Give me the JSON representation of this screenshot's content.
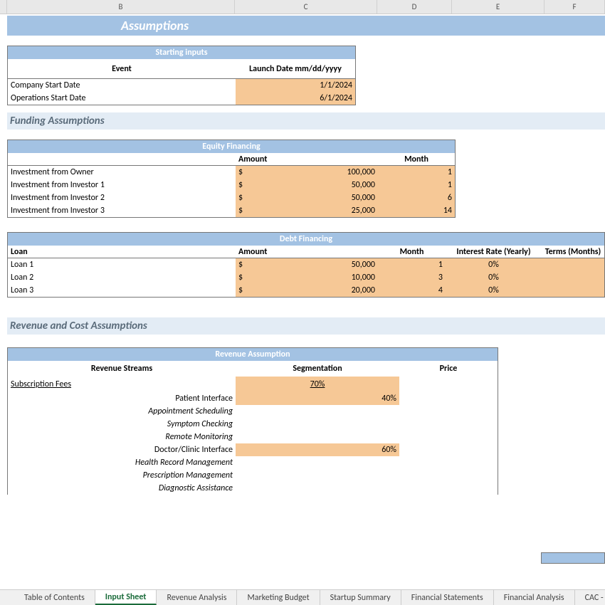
{
  "columns": [
    "B",
    "C",
    "D",
    "E",
    "F"
  ],
  "title": "Assumptions",
  "starting_inputs": {
    "header": "Starting inputs",
    "col_event": "Event",
    "col_date": "Launch Date mm/dd/yyyy",
    "rows": [
      {
        "label": "Company Start Date",
        "value": "1/1/2024"
      },
      {
        "label": "Operations Start Date",
        "value": "6/1/2024"
      }
    ]
  },
  "funding_section": "Funding Assumptions",
  "equity": {
    "header": "Equity Financing",
    "col_amount": "Amount",
    "col_month": "Month",
    "currency": "$",
    "rows": [
      {
        "label": "Investment from Owner",
        "amount": "100,000",
        "month": "1"
      },
      {
        "label": "Investment from Investor 1",
        "amount": "50,000",
        "month": "1"
      },
      {
        "label": "Investment from Investor 2",
        "amount": "50,000",
        "month": "6"
      },
      {
        "label": "Investment from Investor 3",
        "amount": "25,000",
        "month": "14"
      }
    ]
  },
  "debt": {
    "header": "Debt Financing",
    "col_loan": "Loan",
    "col_amount": "Amount",
    "col_month": "Month",
    "col_rate": "Interest Rate (Yearly)",
    "col_terms": "Terms (Months)",
    "currency": "$",
    "rows": [
      {
        "label": "Loan 1",
        "amount": "50,000",
        "month": "1",
        "rate": "0%",
        "terms": ""
      },
      {
        "label": "Loan 2",
        "amount": "10,000",
        "month": "3",
        "rate": "0%",
        "terms": ""
      },
      {
        "label": "Loan 3",
        "amount": "20,000",
        "month": "4",
        "rate": "0%",
        "terms": ""
      }
    ]
  },
  "revenue_section": "Revenue and Cost Assumptions",
  "revenue": {
    "header": "Revenue Assumption",
    "col_streams": "Revenue Streams",
    "col_seg": "Segmentation",
    "col_price": "Price",
    "sub_fees": "Subscription Fees",
    "sub_fees_pct": "70%",
    "patient": "Patient Interface",
    "patient_pct": "40%",
    "features1": [
      "Appointment Scheduling",
      "Symptom Checking",
      "Remote Monitoring"
    ],
    "doctor": "Doctor/Clinic Interface",
    "doctor_pct": "60%",
    "features2": [
      "Health Record Management",
      "Prescription Management",
      "Diagnostic Assistance"
    ]
  },
  "tabs": [
    "Table of Contents",
    "Input Sheet",
    "Revenue Analysis",
    "Marketing Budget",
    "Startup Summary",
    "Financial Statements",
    "Financial Analysis",
    "CAC - CL"
  ],
  "active_tab": 1
}
